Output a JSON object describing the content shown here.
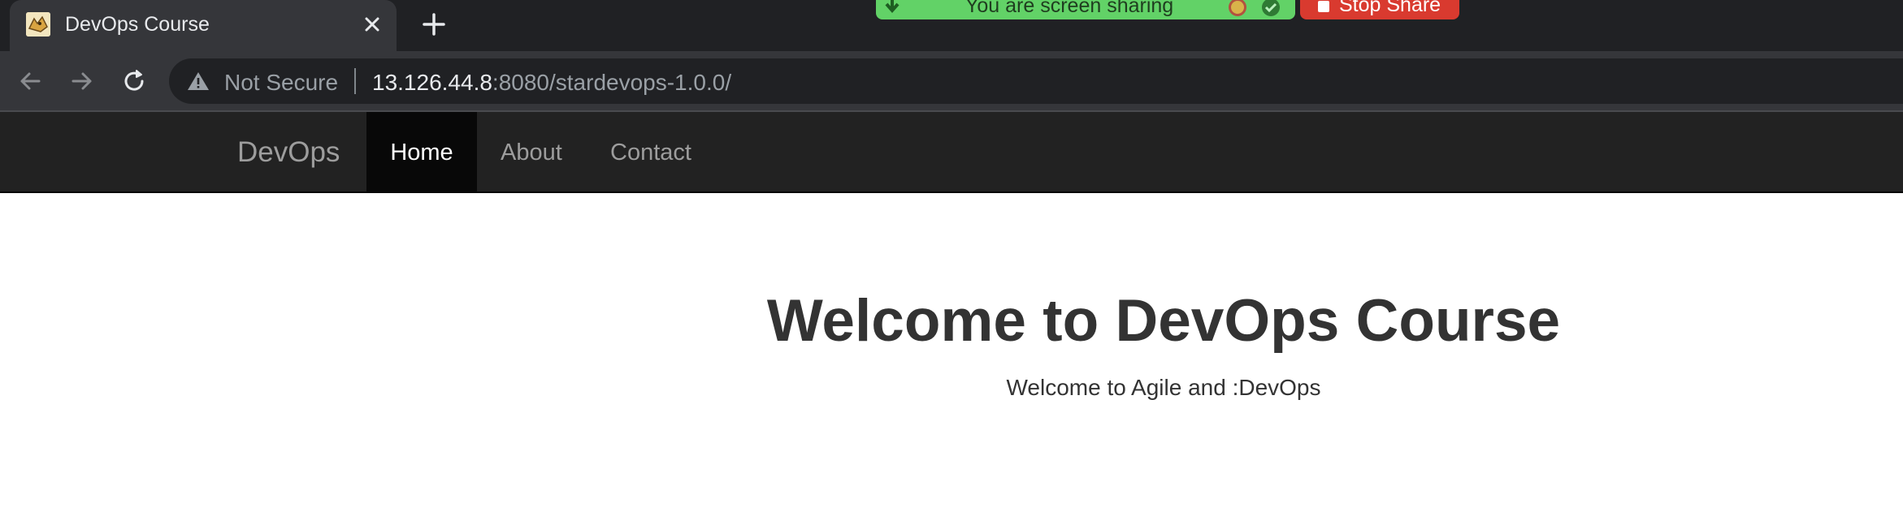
{
  "browser": {
    "tab": {
      "title": "DevOps Course",
      "favicon": "tomcat-favicon-icon"
    },
    "screen_share": {
      "message": "You are screen sharing",
      "stop_label": "Stop Share"
    },
    "address_bar": {
      "security_label": "Not Secure",
      "url_host": "13.126.44.8",
      "url_rest": ":8080/stardevops-1.0.0/"
    }
  },
  "page": {
    "navbar": {
      "brand": "DevOps",
      "items": [
        {
          "label": "Home",
          "active": true
        },
        {
          "label": "About",
          "active": false
        },
        {
          "label": "Contact",
          "active": false
        }
      ]
    },
    "hero": {
      "title": "Welcome to DevOps Course",
      "subtitle": "Welcome to Agile and :DevOps"
    }
  },
  "colors": {
    "navbar_bg": "#222222",
    "navbar_active_bg": "#080808",
    "share_green": "#62d267",
    "stop_red": "#d93a2f"
  }
}
